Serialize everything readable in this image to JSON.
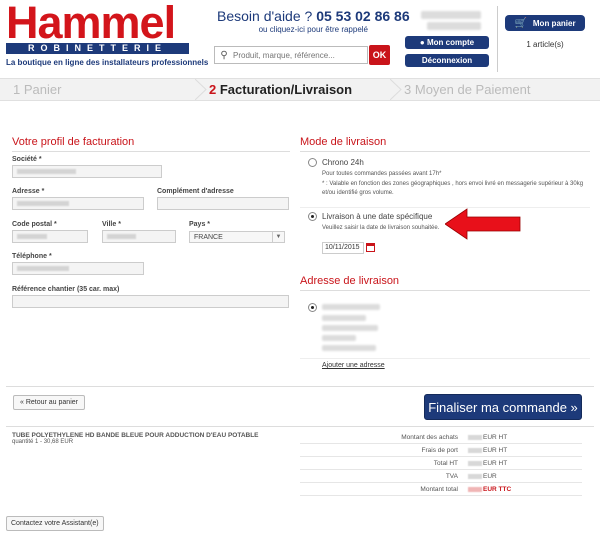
{
  "header": {
    "logo_name": "Hammel",
    "logo_sub": "ROBINETTERIE",
    "tagline": "La boutique en ligne des installateurs professionnels",
    "help_prefix": "Besoin d'aide ?",
    "help_phone": "05 53 02 86 86",
    "help_sub": "ou cliquez-ici pour être rappelé",
    "search_placeholder": "Produit, marque, référence...",
    "search_button": "OK",
    "account_button": "Mon compte",
    "logout_button": "Déconnexion",
    "cart_button": "Mon panier",
    "cart_count": "1 article(s)"
  },
  "steps": [
    {
      "num": "1",
      "label": "Panier"
    },
    {
      "num": "2",
      "label": "Facturation/Livraison"
    },
    {
      "num": "3",
      "label": "Moyen de Paiement"
    }
  ],
  "billing": {
    "title": "Votre profil de facturation",
    "company_label": "Société *",
    "address_label": "Adresse *",
    "address2_label": "Complément d'adresse",
    "postcode_label": "Code postal *",
    "city_label": "Ville *",
    "country_label": "Pays *",
    "country_value": "FRANCE",
    "phone_label": "Téléphone *",
    "reference_label": "Référence chantier (35 car. max)"
  },
  "delivery": {
    "title": "Mode de livraison",
    "option1_title": "Chrono 24h",
    "option1_desc1": "Pour toutes commandes passées avant 17h*",
    "option1_desc2": "* : Valable en fonction des zones géographiques , hors envoi livré en messagerie supérieur à 30kg",
    "option1_desc3": "et/ou identifié gros volume.",
    "option2_title": "Livraison à une date spécifique",
    "option2_desc": "Veuillez saisir la date de livraison souhaitée.",
    "date_value": "10/11/2015"
  },
  "shipping_address": {
    "title": "Adresse de livraison",
    "add_link": "Ajouter une adresse"
  },
  "actions": {
    "back_button": "« Retour au panier",
    "finalize_button": "Finaliser ma commande »",
    "contact_button": "Contactez votre Assistant(e)"
  },
  "product": {
    "name": "TUBE POLYETHYLENE HD BANDE BLEUE POUR ADDUCTION D'EAU POTABLE",
    "detail": "quantité 1 - 30,68 EUR"
  },
  "totals": [
    {
      "label": "Montant des achats",
      "unit": "EUR HT"
    },
    {
      "label": "Frais de port",
      "unit": "EUR HT"
    },
    {
      "label": "Total HT",
      "unit": "EUR HT"
    },
    {
      "label": "TVA",
      "unit": "EUR"
    },
    {
      "label": "Montant total",
      "unit": "EUR TTC"
    }
  ],
  "colors": {
    "brand_red": "#d3151b",
    "brand_blue": "#1d3a7a"
  }
}
